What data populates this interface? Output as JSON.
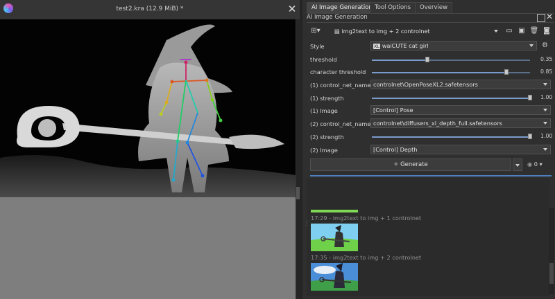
{
  "document": {
    "title": "test2.kra (12.9 MiB) *"
  },
  "tabs": [
    {
      "label": "AI Image Generation",
      "active": true
    },
    {
      "label": "Tool Options",
      "active": false
    },
    {
      "label": "Overview",
      "active": false
    }
  ],
  "docker": {
    "title": "AI Image Generation"
  },
  "workflow": {
    "selected": "img2text to img + 2 controlnet"
  },
  "style": {
    "label": "Style",
    "badge": "XL",
    "value": "waiCUTE cat girl"
  },
  "threshold": {
    "label": "threshold",
    "value": "0.35",
    "fraction": 0.35
  },
  "character_threshold": {
    "label": "character threshold",
    "value": "0.85",
    "fraction": 0.85
  },
  "cn1": {
    "name_label": "(1) control_net_name",
    "name_value": "controlnet\\OpenPoseXL2.safetensors",
    "strength_label": "(1) strength",
    "strength_value": "1.00",
    "strength_fraction": 1.0,
    "image_label": "(1) Image",
    "image_value": "[Control] Pose"
  },
  "cn2": {
    "name_label": "(2) control_net_name",
    "name_value": "controlnet\\diffusers_xl_depth_full.safetensors",
    "strength_label": "(2) strength",
    "strength_value": "1.00",
    "strength_fraction": 1.0,
    "image_label": "(2) Image",
    "image_value": "[Control] Depth"
  },
  "generate": {
    "label": "Generate",
    "queue": "0"
  },
  "history": [
    {
      "label": "17:29 - img2text to img + 1 controlnet"
    },
    {
      "label": "17:35 - img2text to img + 2 controlnet"
    }
  ],
  "colors": {
    "accent": "#4e7fbf",
    "panel": "#2f2f2f",
    "canvas_bg": "#030303",
    "canvas_empty": "#7e7e7e"
  }
}
